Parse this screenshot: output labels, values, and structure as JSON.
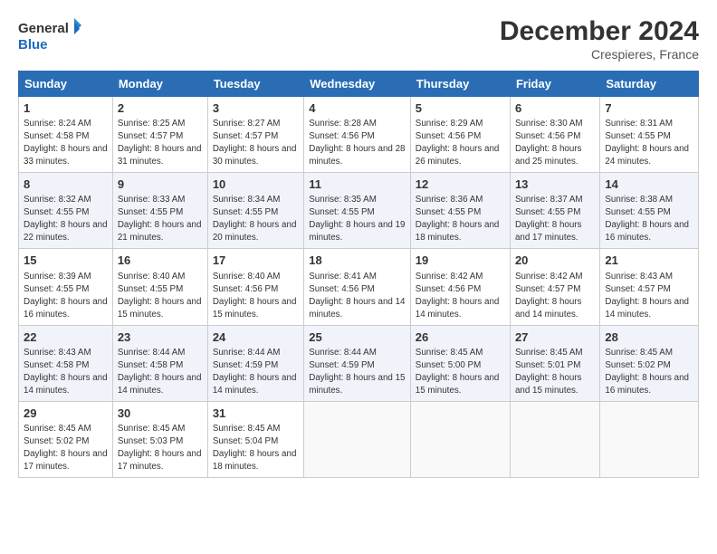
{
  "logo": {
    "line1": "General",
    "line2": "Blue"
  },
  "title": "December 2024",
  "subtitle": "Crespieres, France",
  "header_days": [
    "Sunday",
    "Monday",
    "Tuesday",
    "Wednesday",
    "Thursday",
    "Friday",
    "Saturday"
  ],
  "weeks": [
    [
      {
        "day": "1",
        "sunrise": "8:24 AM",
        "sunset": "4:58 PM",
        "daylight": "8 hours and 33 minutes."
      },
      {
        "day": "2",
        "sunrise": "8:25 AM",
        "sunset": "4:57 PM",
        "daylight": "8 hours and 31 minutes."
      },
      {
        "day": "3",
        "sunrise": "8:27 AM",
        "sunset": "4:57 PM",
        "daylight": "8 hours and 30 minutes."
      },
      {
        "day": "4",
        "sunrise": "8:28 AM",
        "sunset": "4:56 PM",
        "daylight": "8 hours and 28 minutes."
      },
      {
        "day": "5",
        "sunrise": "8:29 AM",
        "sunset": "4:56 PM",
        "daylight": "8 hours and 26 minutes."
      },
      {
        "day": "6",
        "sunrise": "8:30 AM",
        "sunset": "4:56 PM",
        "daylight": "8 hours and 25 minutes."
      },
      {
        "day": "7",
        "sunrise": "8:31 AM",
        "sunset": "4:55 PM",
        "daylight": "8 hours and 24 minutes."
      }
    ],
    [
      {
        "day": "8",
        "sunrise": "8:32 AM",
        "sunset": "4:55 PM",
        "daylight": "8 hours and 22 minutes."
      },
      {
        "day": "9",
        "sunrise": "8:33 AM",
        "sunset": "4:55 PM",
        "daylight": "8 hours and 21 minutes."
      },
      {
        "day": "10",
        "sunrise": "8:34 AM",
        "sunset": "4:55 PM",
        "daylight": "8 hours and 20 minutes."
      },
      {
        "day": "11",
        "sunrise": "8:35 AM",
        "sunset": "4:55 PM",
        "daylight": "8 hours and 19 minutes."
      },
      {
        "day": "12",
        "sunrise": "8:36 AM",
        "sunset": "4:55 PM",
        "daylight": "8 hours and 18 minutes."
      },
      {
        "day": "13",
        "sunrise": "8:37 AM",
        "sunset": "4:55 PM",
        "daylight": "8 hours and 17 minutes."
      },
      {
        "day": "14",
        "sunrise": "8:38 AM",
        "sunset": "4:55 PM",
        "daylight": "8 hours and 16 minutes."
      }
    ],
    [
      {
        "day": "15",
        "sunrise": "8:39 AM",
        "sunset": "4:55 PM",
        "daylight": "8 hours and 16 minutes."
      },
      {
        "day": "16",
        "sunrise": "8:40 AM",
        "sunset": "4:55 PM",
        "daylight": "8 hours and 15 minutes."
      },
      {
        "day": "17",
        "sunrise": "8:40 AM",
        "sunset": "4:56 PM",
        "daylight": "8 hours and 15 minutes."
      },
      {
        "day": "18",
        "sunrise": "8:41 AM",
        "sunset": "4:56 PM",
        "daylight": "8 hours and 14 minutes."
      },
      {
        "day": "19",
        "sunrise": "8:42 AM",
        "sunset": "4:56 PM",
        "daylight": "8 hours and 14 minutes."
      },
      {
        "day": "20",
        "sunrise": "8:42 AM",
        "sunset": "4:57 PM",
        "daylight": "8 hours and 14 minutes."
      },
      {
        "day": "21",
        "sunrise": "8:43 AM",
        "sunset": "4:57 PM",
        "daylight": "8 hours and 14 minutes."
      }
    ],
    [
      {
        "day": "22",
        "sunrise": "8:43 AM",
        "sunset": "4:58 PM",
        "daylight": "8 hours and 14 minutes."
      },
      {
        "day": "23",
        "sunrise": "8:44 AM",
        "sunset": "4:58 PM",
        "daylight": "8 hours and 14 minutes."
      },
      {
        "day": "24",
        "sunrise": "8:44 AM",
        "sunset": "4:59 PM",
        "daylight": "8 hours and 14 minutes."
      },
      {
        "day": "25",
        "sunrise": "8:44 AM",
        "sunset": "4:59 PM",
        "daylight": "8 hours and 15 minutes."
      },
      {
        "day": "26",
        "sunrise": "8:45 AM",
        "sunset": "5:00 PM",
        "daylight": "8 hours and 15 minutes."
      },
      {
        "day": "27",
        "sunrise": "8:45 AM",
        "sunset": "5:01 PM",
        "daylight": "8 hours and 15 minutes."
      },
      {
        "day": "28",
        "sunrise": "8:45 AM",
        "sunset": "5:02 PM",
        "daylight": "8 hours and 16 minutes."
      }
    ],
    [
      {
        "day": "29",
        "sunrise": "8:45 AM",
        "sunset": "5:02 PM",
        "daylight": "8 hours and 17 minutes."
      },
      {
        "day": "30",
        "sunrise": "8:45 AM",
        "sunset": "5:03 PM",
        "daylight": "8 hours and 17 minutes."
      },
      {
        "day": "31",
        "sunrise": "8:45 AM",
        "sunset": "5:04 PM",
        "daylight": "8 hours and 18 minutes."
      },
      null,
      null,
      null,
      null
    ]
  ],
  "labels": {
    "sunrise": "Sunrise: ",
    "sunset": "Sunset: ",
    "daylight": "Daylight: "
  }
}
